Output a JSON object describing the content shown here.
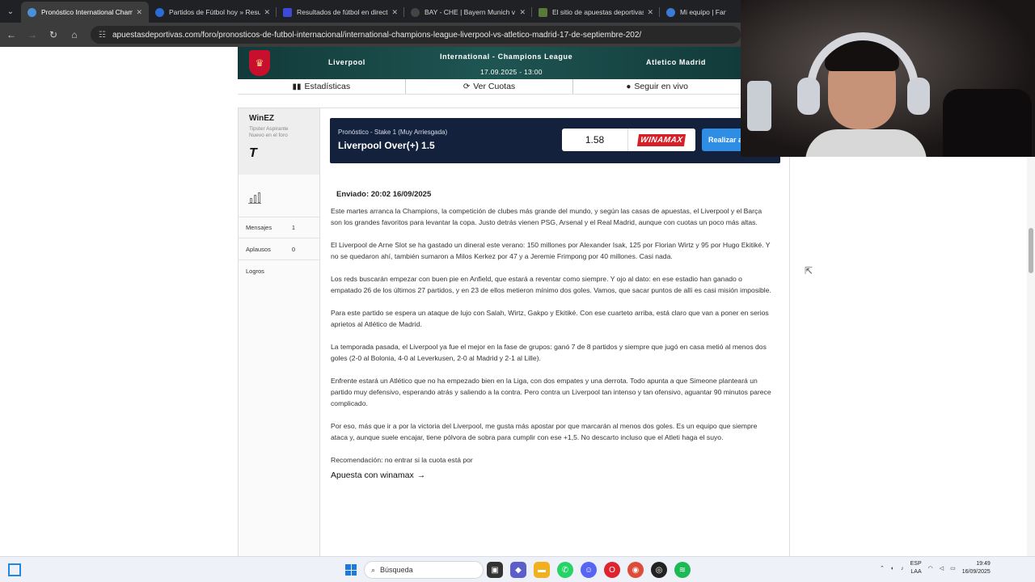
{
  "browser": {
    "tabs": [
      {
        "title": "Pronóstico International Champ",
        "active": true
      },
      {
        "title": "Partidos de Fútbol hoy » Result"
      },
      {
        "title": "Resultados de fútbol en directo"
      },
      {
        "title": "BAY - CHE | Bayern Munich v C"
      },
      {
        "title": "El sitio de apuestas deportivas"
      },
      {
        "title": "Mi equipo | Fantasy F"
      }
    ],
    "url": "apuestasdeportivas.com/foro/pronosticos-de-futbol-internacional/international-champions-league-liverpool-vs-atletico-madrid-17-de-septiembre-202/"
  },
  "match": {
    "home": "Liverpool",
    "competition": "International - Champions League",
    "datetime": "17.09.2025 - 13:00",
    "away": "Atletico Madrid"
  },
  "tools": {
    "stats": "Estadísticas",
    "odds": "Ver Cuotas",
    "live": "Seguir en vivo"
  },
  "user": {
    "name": "WinEZ",
    "rank_line1": "Tipster Aspirante",
    "rank_line2": "Nuevo en el foro",
    "messages_label": "Mensajes",
    "messages_count": "1",
    "applause_label": "Aplausos",
    "applause_count": "0",
    "achievements_label": "Logros"
  },
  "pick": {
    "kicker": "Pronóstico - Stake 1 (Muy Arriesgada)",
    "title": "Liverpool Over(+) 1.5",
    "odds": "1.58",
    "bookmaker": "WINAMAX",
    "cta": "Realizar a"
  },
  "post": {
    "sent": "Enviado: 20:02 16/09/2025",
    "paragraphs": [
      "Este martes arranca la Champions, la competición de clubes más grande del mundo, y según las casas de apuestas, el Liverpool y el Barça son los grandes favoritos para levantar la copa. Justo detrás vienen PSG, Arsenal y el Real Madrid, aunque con cuotas un poco más altas.",
      "El Liverpool de Arne Slot se ha gastado un dineral este verano: 150 millones por Alexander Isak, 125 por Florian Wirtz y 95 por Hugo Ekitiké. Y no se quedaron ahí, también sumaron a Milos Kerkez por 47 y a Jeremie Frimpong por 40 millones. Casi nada.",
      "Los reds buscarán empezar con buen pie en Anfield, que estará a reventar como siempre. Y ojo al dato: en ese estadio han ganado o empatado 26 de los últimos 27 partidos, y en 23 de ellos metieron mínimo dos goles. Vamos, que sacar puntos de allí es casi misión imposible.",
      "Para este partido se espera un ataque de lujo con Salah, Wirtz, Gakpo y Ekitiké. Con ese cuarteto arriba, está claro que van a poner en serios aprietos al Atlético de Madrid.",
      "La temporada pasada, el Liverpool ya fue el mejor en la fase de grupos: ganó 7 de 8 partidos y siempre que jugó en casa metió al menos dos goles (2-0 al Bolonia, 4-0 al Leverkusen, 2-0 al Madrid y 2-1 al Lille).",
      "Enfrente estará un Atlético que no ha empezado bien en la Liga, con dos empates y una derrota. Todo apunta a que Simeone planteará un partido muy defensivo, esperando atrás y saliendo a la contra. Pero contra un Liverpool tan intenso y tan ofensivo, aguantar 90 minutos parece complicado.",
      "Por eso, más que ir a por la victoria del Liverpool, me gusta más apostar por que marcarán al menos dos goles. Es un equipo que siempre ataca y, aunque suele encajar, tiene pólvora de sobra para cumplir con ese +1,5. No descarto incluso que el Atleti haga el suyo.",
      "Recomendación: no entrar si la cuota está por"
    ],
    "bet_link": "Apuesta con winamax"
  },
  "taskbar": {
    "search_placeholder": "Búsqueda",
    "lang1": "ESP",
    "lang2": "LAA",
    "time": "19:49",
    "date": "16/09/2025"
  },
  "icons": {
    "stats": "bar-chart-icon",
    "odds": "refresh-icon",
    "live": "live-dot-icon",
    "arrow": "arrow-right-icon"
  },
  "colors": {
    "banner": "#14213d",
    "cta": "#2e8de5",
    "bookmaker": "#d61f26",
    "header": "#1e5552"
  }
}
